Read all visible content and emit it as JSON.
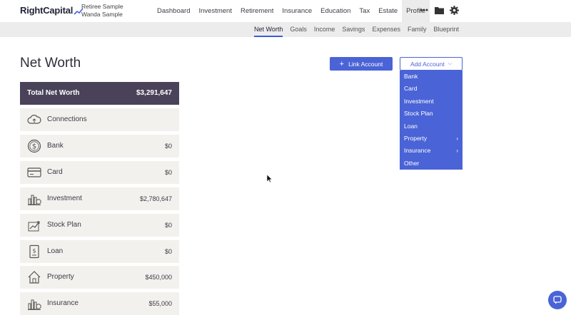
{
  "header": {
    "logo_text": "RightCapital",
    "client_line1": "Retiree Sample",
    "client_line2": "Wanda Sample",
    "nav": [
      "Dashboard",
      "Investment",
      "Retirement",
      "Insurance",
      "Education",
      "Tax",
      "Estate",
      "Profile"
    ],
    "active_nav": "Profile"
  },
  "subnav": {
    "items": [
      "Net Worth",
      "Goals",
      "Income",
      "Savings",
      "Expenses",
      "Family",
      "Blueprint"
    ],
    "active": "Net Worth"
  },
  "page": {
    "title": "Net Worth",
    "link_account_label": "Link Account",
    "add_account_label": "Add Account"
  },
  "dropdown": {
    "items": [
      "Bank",
      "Card",
      "Investment",
      "Stock Plan",
      "Loan",
      "Property",
      "Insurance",
      "Other"
    ]
  },
  "total": {
    "label": "Total Net Worth",
    "value": "$3,291,647"
  },
  "accounts": [
    {
      "label": "Connections",
      "value": "",
      "icon": "cloud-sync-icon"
    },
    {
      "label": "Bank",
      "value": "$0",
      "icon": "dollar-coin-icon"
    },
    {
      "label": "Card",
      "value": "$0",
      "icon": "credit-card-icon"
    },
    {
      "label": "Investment",
      "value": "$2,780,647",
      "icon": "bar-chart-icon"
    },
    {
      "label": "Stock Plan",
      "value": "$0",
      "icon": "stock-chart-icon"
    },
    {
      "label": "Loan",
      "value": "$0",
      "icon": "loan-document-icon"
    },
    {
      "label": "Property",
      "value": "$450,000",
      "icon": "house-icon"
    },
    {
      "label": "Insurance",
      "value": "$55,000",
      "icon": "insurance-chart-icon"
    }
  ],
  "colors": {
    "accent": "#4a63d6",
    "total_bg": "#4a4259",
    "row_bg": "#f3f1ed"
  }
}
